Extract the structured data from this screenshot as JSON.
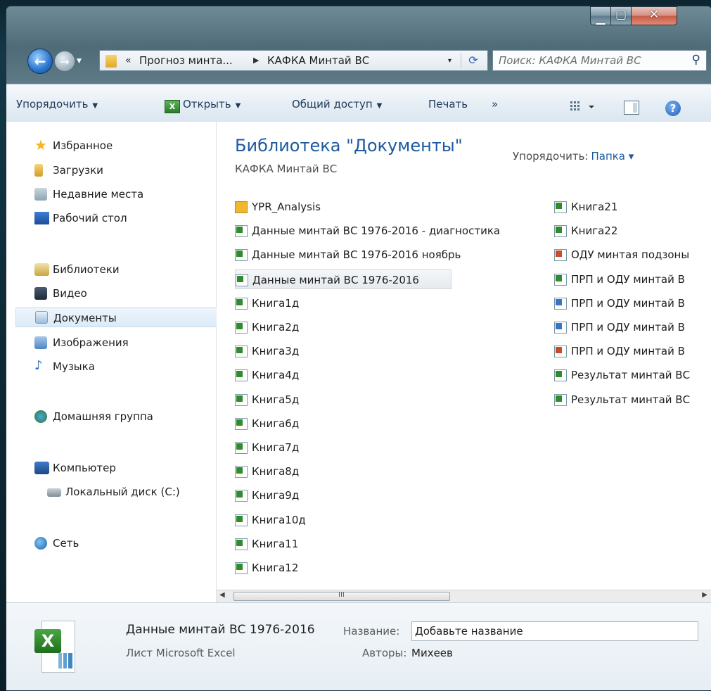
{
  "window": {
    "min_glyph": "▁",
    "max_glyph": "▢",
    "close_glyph": "✕"
  },
  "address": {
    "history_glyph": "«",
    "crumb1": "Прогноз минта...",
    "sep": "▶",
    "crumb2": "КАФКА Минтай ВС",
    "dropdown": "▾",
    "refresh": "⟳"
  },
  "search": {
    "placeholder": "Поиск: КАФКА Минтай ВС",
    "icon": "⚲"
  },
  "toolbar": {
    "organize": "Упорядочить",
    "open": "Открыть",
    "share": "Общий доступ",
    "print": "Печать",
    "more": "»"
  },
  "nav": {
    "favorites": "Избранное",
    "downloads": "Загрузки",
    "recent": "Недавние места",
    "desktop": "Рабочий стол",
    "libraries": "Библиотеки",
    "video": "Видео",
    "documents": "Документы",
    "images": "Изображения",
    "music": "Музыка",
    "homegroup": "Домашняя группа",
    "computer": "Компьютер",
    "localdisk": "Локальный диск (C:)",
    "network": "Сеть"
  },
  "library": {
    "title": "Библиотека \"Документы\"",
    "subtitle": "КАФКА Минтай ВС",
    "arrange_label": "Упорядочить:",
    "arrange_value": "Папка"
  },
  "files_col1": [
    {
      "name": "YPR_Analysis",
      "type": "mdb"
    },
    {
      "name": "Данные минтай ВС 1976-2016 - диагностика",
      "type": "xl"
    },
    {
      "name": "Данные минтай ВС 1976-2016 ноябрь",
      "type": "xl"
    },
    {
      "name": "Данные минтай ВС 1976-2016",
      "type": "xl"
    },
    {
      "name": "Книга1д",
      "type": "xl"
    },
    {
      "name": "Книга2д",
      "type": "xl"
    },
    {
      "name": "Книга3д",
      "type": "xl"
    },
    {
      "name": "Книга4д",
      "type": "xl"
    },
    {
      "name": "Книга5д",
      "type": "xl"
    },
    {
      "name": "Книга6д",
      "type": "xl"
    },
    {
      "name": "Книга7д",
      "type": "xl"
    },
    {
      "name": "Книга8д",
      "type": "xl"
    },
    {
      "name": "Книга9д",
      "type": "xl"
    },
    {
      "name": "Книга10д",
      "type": "xl"
    },
    {
      "name": "Книга11",
      "type": "xl"
    },
    {
      "name": "Книга12",
      "type": "xl"
    }
  ],
  "files_col2": [
    {
      "name": "Книга21",
      "type": "xl"
    },
    {
      "name": "Книга22",
      "type": "xl"
    },
    {
      "name": "ОДУ минтая подзоны",
      "type": "ppt"
    },
    {
      "name": "ПРП и ОДУ минтай В",
      "type": "xl"
    },
    {
      "name": "ПРП и ОДУ минтай В",
      "type": "pp2"
    },
    {
      "name": "ПРП и ОДУ минтай В",
      "type": "pp2"
    },
    {
      "name": "ПРП и ОДУ минтай В",
      "type": "ppt"
    },
    {
      "name": "Результат  минтай ВС",
      "type": "xl"
    },
    {
      "name": "Результат минтай ВС",
      "type": "xl"
    }
  ],
  "details": {
    "name": "Данные минтай ВС 1976-2016",
    "type": "Лист Microsoft Excel",
    "title_label": "Название:",
    "title_value": "Добавьте название",
    "authors_label": "Авторы:",
    "authors_value": "Михеев"
  },
  "scroll": {
    "grip": "III",
    "left": "◀",
    "right": "▶"
  }
}
